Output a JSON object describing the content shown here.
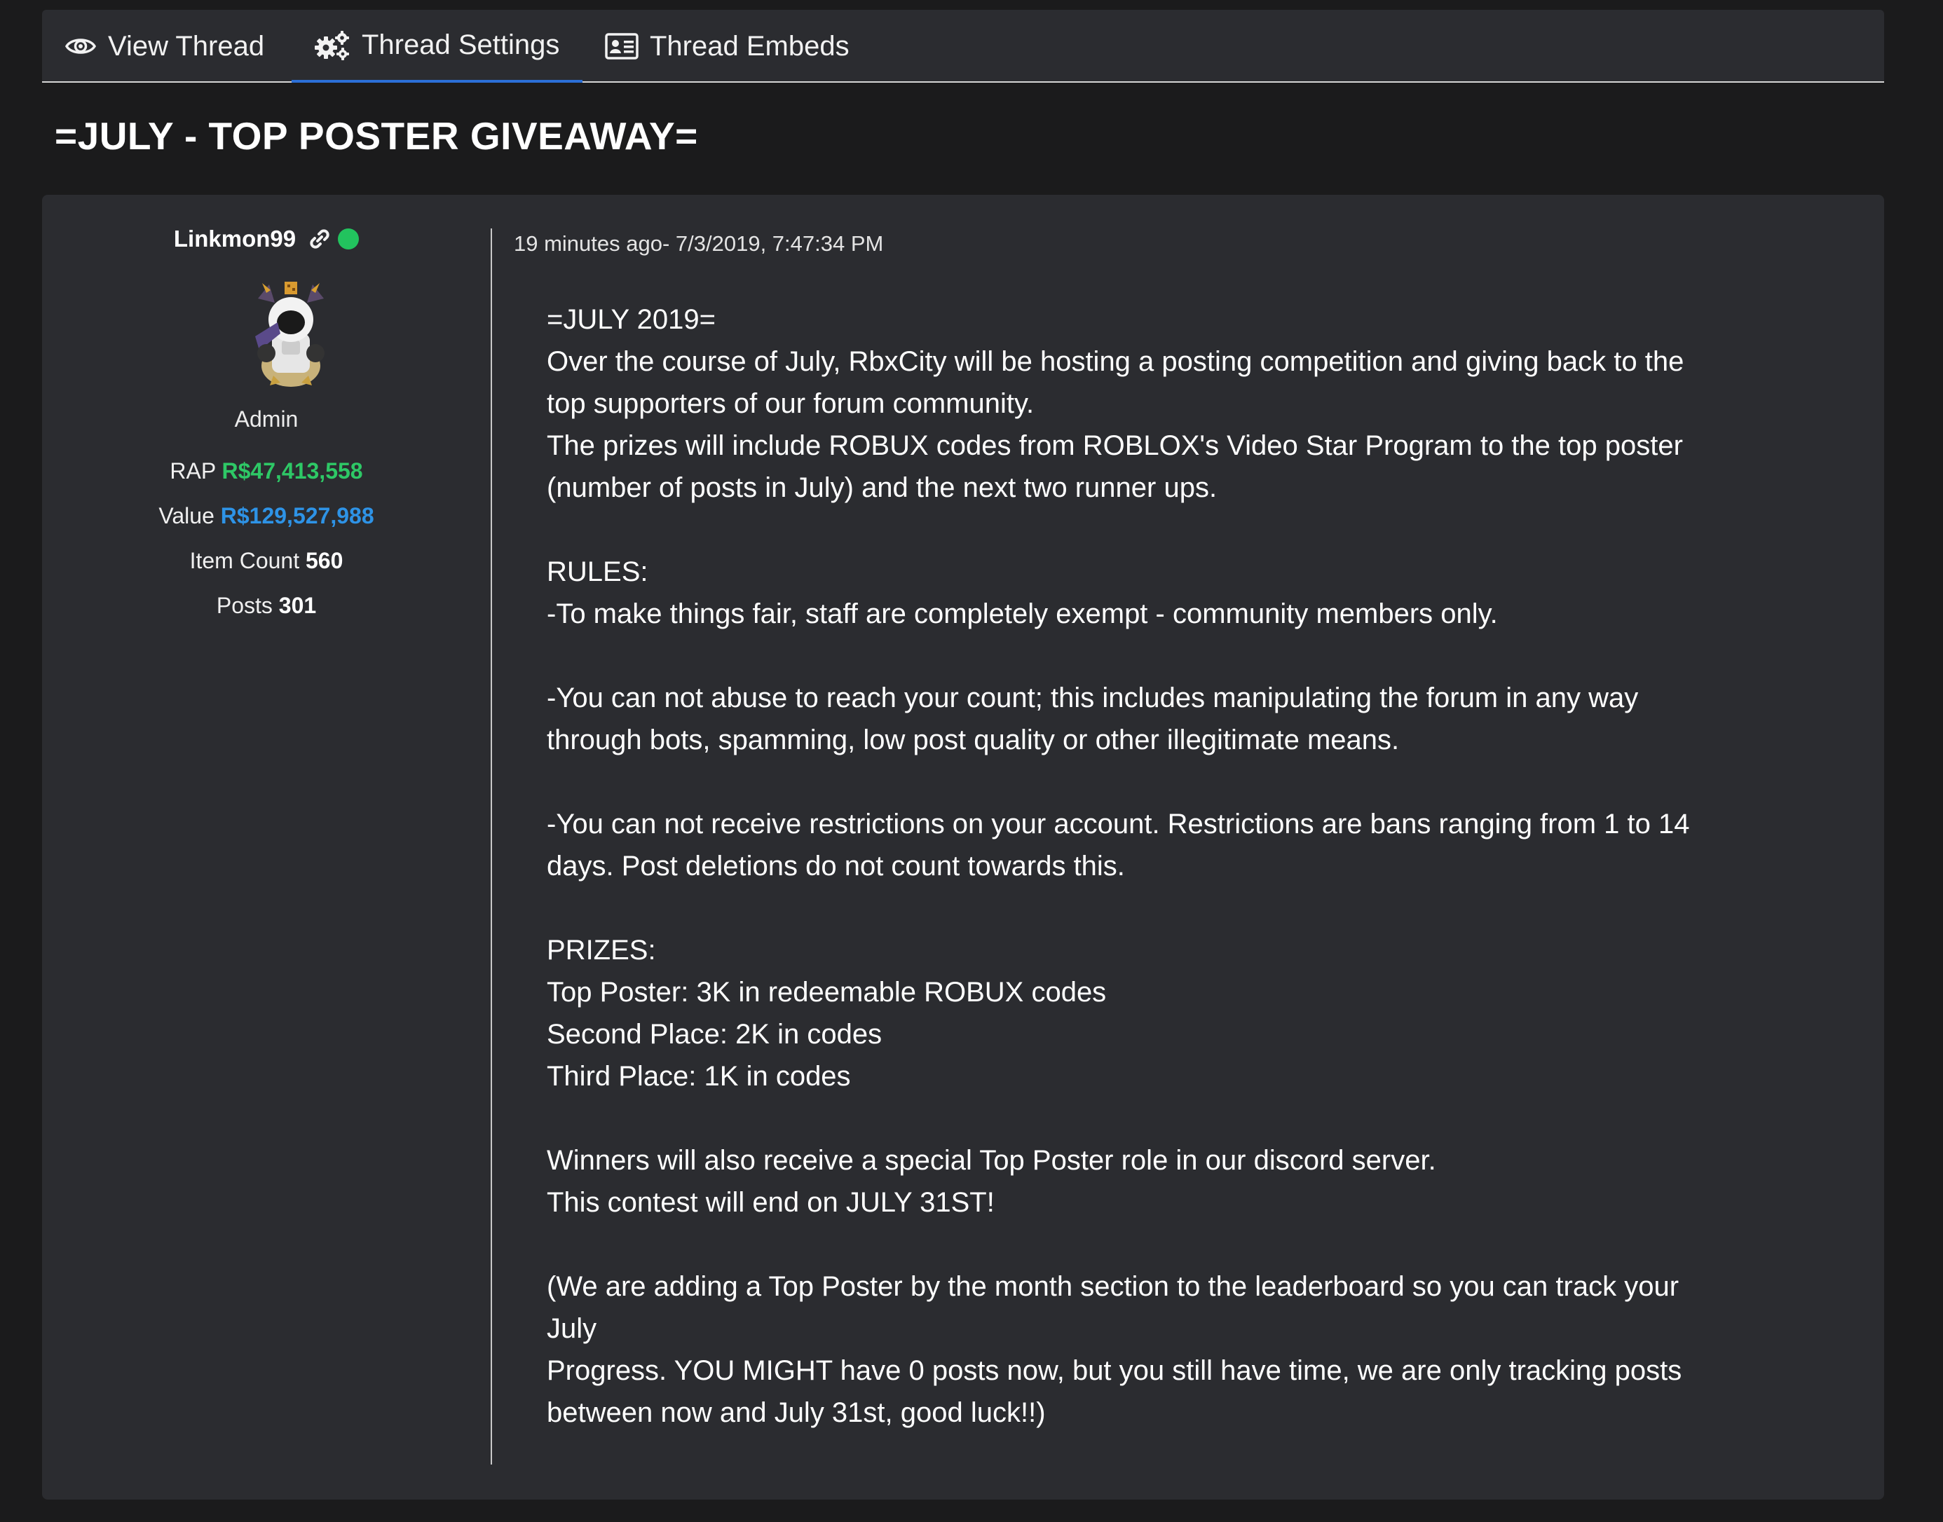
{
  "tabs": [
    {
      "label": "View Thread",
      "icon": "eye-icon"
    },
    {
      "label": "Thread Settings",
      "icon": "gears-icon"
    },
    {
      "label": "Thread Embeds",
      "icon": "id-card-icon"
    }
  ],
  "active_tab": "Thread Settings",
  "accent_color": "#2b6fd6",
  "thread": {
    "title": "=JULY - TOP POSTER GIVEAWAY="
  },
  "author": {
    "username": "Linkmon99",
    "online": true,
    "role": "Admin",
    "rap_label": "RAP",
    "rap_value": "R$47,413,558",
    "value_label": "Value",
    "value_value": "R$129,527,988",
    "item_count_label": "Item Count",
    "item_count_value": "560",
    "posts_label": "Posts",
    "posts_value": "301"
  },
  "post": {
    "timestamp": "19 minutes ago- 7/3/2019, 7:47:34 PM",
    "lines": [
      "=JULY 2019=",
      "Over the course of July, RbxCity will be hosting a posting competition and giving back to the",
      "top supporters of our forum community.",
      "The prizes will include ROBUX codes from ROBLOX's Video Star Program to the top poster",
      "(number of posts in July) and the next two runner ups.",
      "",
      "RULES:",
      "-To make things fair, staff are completely exempt - community members only.",
      "",
      "-You can not abuse to reach your count; this includes manipulating the forum in any way",
      "through bots, spamming, low post quality or other illegitimate means.",
      "",
      "-You can not receive restrictions on your account. Restrictions are bans ranging from 1 to 14",
      "days. Post deletions do not count towards this.",
      "",
      "PRIZES:",
      "Top Poster: 3K in redeemable ROBUX codes",
      "Second Place: 2K in codes",
      "Third Place: 1K in codes",
      "",
      "Winners will also receive a special Top Poster role in our discord server.",
      "This contest will end on JULY 31ST!",
      "",
      "(We are adding a Top Poster by the month section to the leaderboard so you can track your",
      "July",
      "Progress. YOU MIGHT have 0 posts now, but you still have time, we are only tracking posts",
      "between now and July 31st, good luck!!)"
    ]
  }
}
